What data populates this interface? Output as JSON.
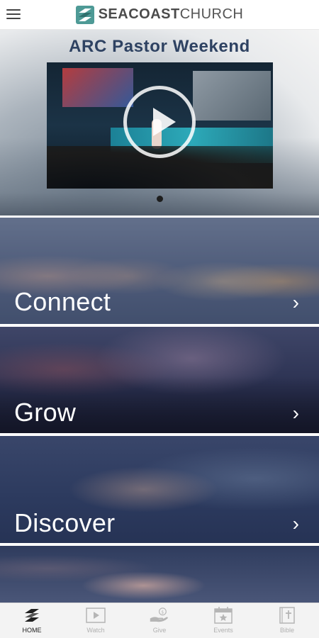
{
  "header": {
    "menu_icon": "hamburger-menu-icon",
    "logo_bold": "SEACOAST",
    "logo_light": "CHURCH",
    "logo_color": "#4e9a96"
  },
  "hero": {
    "title": "ARC Pastor Weekend",
    "play_icon": "play-circle-icon",
    "carousel_pages": 1,
    "carousel_active": 1
  },
  "sections": [
    {
      "label": "Connect",
      "chevron": "›"
    },
    {
      "label": "Grow",
      "chevron": "›"
    },
    {
      "label": "Discover",
      "chevron": "›"
    }
  ],
  "tabbar": {
    "active_color": "#222222",
    "inactive_color": "#b0b0b0",
    "items": [
      {
        "label": "HOME",
        "icon": "seacoast-logo-icon",
        "active": true
      },
      {
        "label": "Watch",
        "icon": "video-play-icon",
        "active": false
      },
      {
        "label": "Give",
        "icon": "hand-coin-icon",
        "active": false
      },
      {
        "label": "Events",
        "icon": "calendar-star-icon",
        "active": false
      },
      {
        "label": "Bible",
        "icon": "bible-cross-icon",
        "active": false
      }
    ]
  }
}
